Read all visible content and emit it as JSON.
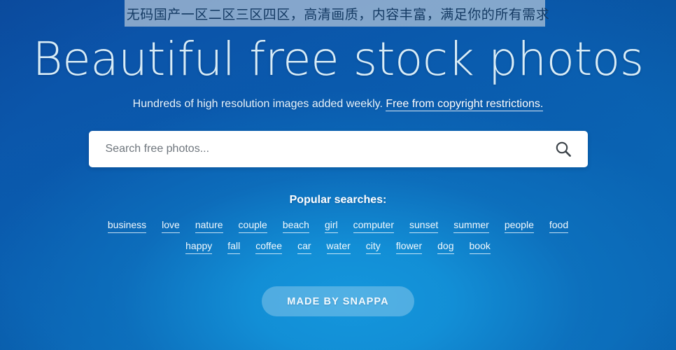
{
  "overlay": {
    "banner_text": "无码国产一区二区三区四区，高清画质，内容丰富，满足你的所有需求"
  },
  "hero": {
    "title": "Beautiful free stock photos",
    "subtitle_text": "Hundreds of high resolution images added weekly.",
    "subtitle_link": "Free from copyright restrictions."
  },
  "search": {
    "placeholder": "Search free photos...",
    "value": "",
    "icon": "search-icon"
  },
  "popular": {
    "heading": "Popular searches:",
    "row1": [
      "business",
      "love",
      "nature",
      "couple",
      "beach",
      "girl",
      "computer",
      "sunset",
      "summer",
      "people",
      "food"
    ],
    "row2": [
      "happy",
      "fall",
      "coffee",
      "car",
      "water",
      "city",
      "flower",
      "dog",
      "book"
    ]
  },
  "footer": {
    "made_by_label": "MADE BY SNAPPA"
  },
  "colors": {
    "background_top": "#0b50a8",
    "background_mid": "#0a66b4",
    "background_glow": "#1496dc",
    "title_text": "#d8ecf7",
    "tag_text": "#f2f9fd",
    "search_background": "#ffffff",
    "search_icon": "#3b4248",
    "overlay_band": "#d0d8e0",
    "overlay_text": "#143a63",
    "button_background": "rgba(255,255,255,0.26)"
  }
}
